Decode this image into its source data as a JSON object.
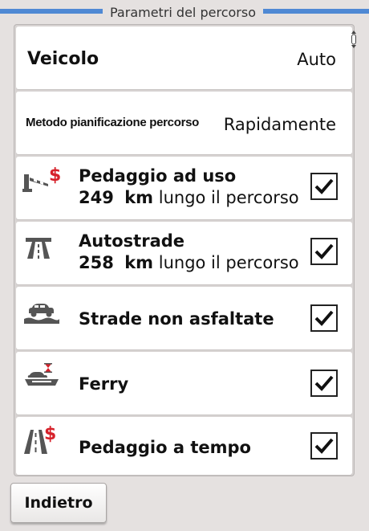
{
  "header": {
    "title": "Parametri del percorso"
  },
  "vehicle": {
    "label": "Veicolo",
    "value": "Auto"
  },
  "method": {
    "label": "Metodo pianificazione percorso",
    "value": "Rapidamente"
  },
  "toll_usage": {
    "title": "Pedaggio ad uso",
    "distance": "249",
    "unit": "km",
    "suffix": "lungo il percorso",
    "checked": true,
    "icon": "toll-road-icon"
  },
  "highways": {
    "title": "Autostrade",
    "distance": "258",
    "unit": "km",
    "suffix": "lungo il percorso",
    "checked": true,
    "icon": "highway-icon"
  },
  "unpaved": {
    "title": "Strade non asfaltate",
    "checked": true,
    "icon": "unpaved-road-icon"
  },
  "ferry": {
    "title": "Ferry",
    "checked": true,
    "icon": "ferry-icon"
  },
  "time_toll": {
    "title": "Pedaggio a tempo",
    "checked": true,
    "icon": "time-toll-icon"
  },
  "footer": {
    "back_label": "Indietro"
  },
  "colors": {
    "accent": "#4f89d4",
    "toll": "#d6212a"
  }
}
